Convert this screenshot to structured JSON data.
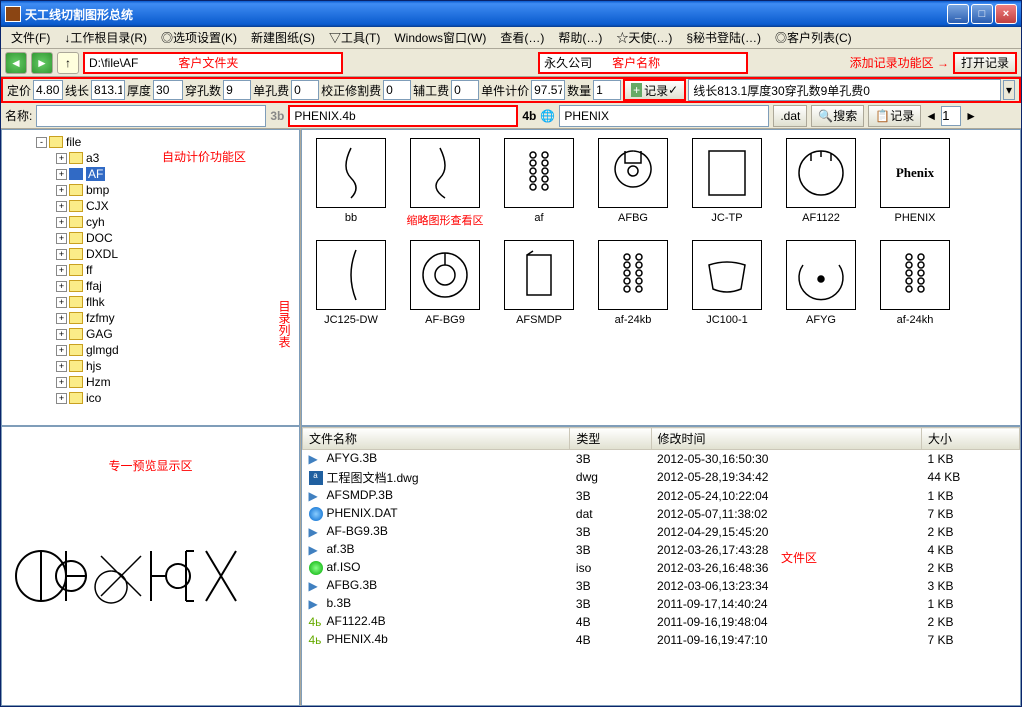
{
  "title": "天工线切割图形总统",
  "menu": [
    "文件(F)",
    "↓工作根目录(R)",
    "◎选项设置(K)",
    "新建图纸(S)",
    "▽工具(T)",
    "Windows窗口(W)",
    "查看(…)",
    "帮助(…)",
    "☆天使(…)",
    "§秘书登陆(…)",
    "◎客户列表(C)"
  ],
  "nav": {
    "path": "D:\\file\\AF"
  },
  "annotations": {
    "customer_folder": "客户文件夹",
    "customer_name": "客户名称",
    "add_record_area": "添加记录功能区 →",
    "open_record": "打开记录",
    "auto_price_area": "自动计价功能区",
    "thumb_area": "缩略图形查看区",
    "dir_list": "目录列表",
    "preview_area": "专一预览显示区",
    "file_area": "文件区"
  },
  "customer": "永久公司",
  "pricing": {
    "dj_label": "定价",
    "dj": "4.80",
    "xc_label": "线长",
    "xc": "813.1",
    "hd_label": "厚度",
    "hd": "30",
    "cks_label": "穿孔数",
    "cks": "9",
    "dkf_label": "单孔费",
    "dkf": "0",
    "jzxgf_label": "校正修割费",
    "jzxgf": "0",
    "fgf_label": "辅工费",
    "fgf": "0",
    "djjj_label": "单件计价",
    "djjj": "97.57",
    "sl_label": "数量",
    "sl": "1",
    "record_btn": "记录",
    "record_text": "线长813.1厚度30穿孔数9单孔费0"
  },
  "namebar": {
    "name_label": "名称:",
    "name_val": "",
    "f3b": "3b",
    "f4b_val": "PHENIX.4b",
    "f4b": "4b",
    "dat_val": "PHENIX",
    "dat_ext": ".dat",
    "search": "搜索",
    "record2": "记录",
    "page": "1"
  },
  "tree": {
    "root": "file",
    "children": [
      "a3",
      "AF",
      "bmp",
      "CJX",
      "cyh",
      "DOC",
      "DXDL",
      "ff",
      "ffaj",
      "flhk",
      "fzfmy",
      "GAG",
      "glmgd",
      "hjs",
      "Hzm",
      "ico"
    ],
    "selected": "AF"
  },
  "thumbs": [
    {
      "label": "bb",
      "svg": "curve1"
    },
    {
      "label": "",
      "svg": "curve2",
      "redtext": true
    },
    {
      "label": "af",
      "svg": "dots"
    },
    {
      "label": "AFBG",
      "svg": "bulb"
    },
    {
      "label": "JC-TP",
      "svg": "rect"
    },
    {
      "label": "AF1122",
      "svg": "circle1"
    },
    {
      "label": "PHENIX",
      "svg": "text",
      "text": "Phenix"
    },
    {
      "label": "JC125-DW",
      "svg": "curve3"
    },
    {
      "label": "AF-BG9",
      "svg": "circle2"
    },
    {
      "label": "AFSMDP",
      "svg": "rect2"
    },
    {
      "label": "af-24kb",
      "svg": "dots"
    },
    {
      "label": "JC100-1",
      "svg": "trap"
    },
    {
      "label": "AFYG",
      "svg": "arc"
    },
    {
      "label": "af-24kh",
      "svg": "dots"
    }
  ],
  "filelist": {
    "cols": [
      "文件名称",
      "类型",
      "修改时间",
      "大小"
    ],
    "rows": [
      {
        "icon": "3b",
        "name": "AFYG.3B",
        "type": "3B",
        "mtime": "2012-05-30,16:50:30",
        "size": "1 KB"
      },
      {
        "icon": "dwg",
        "name": "工程图文档1.dwg",
        "type": "dwg",
        "mtime": "2012-05-28,19:34:42",
        "size": "44 KB"
      },
      {
        "icon": "3b",
        "name": "AFSMDP.3B",
        "type": "3B",
        "mtime": "2012-05-24,10:22:04",
        "size": "1 KB"
      },
      {
        "icon": "dat",
        "name": "PHENIX.DAT",
        "type": "dat",
        "mtime": "2012-05-07,11:38:02",
        "size": "7 KB"
      },
      {
        "icon": "3b",
        "name": "AF-BG9.3B",
        "type": "3B",
        "mtime": "2012-04-29,15:45:20",
        "size": "2 KB"
      },
      {
        "icon": "3b",
        "name": "af.3B",
        "type": "3B",
        "mtime": "2012-03-26,17:43:28",
        "size": "4 KB"
      },
      {
        "icon": "iso",
        "name": "af.ISO",
        "type": "iso",
        "mtime": "2012-03-26,16:48:36",
        "size": "2 KB"
      },
      {
        "icon": "3b",
        "name": "AFBG.3B",
        "type": "3B",
        "mtime": "2012-03-06,13:23:34",
        "size": "3 KB"
      },
      {
        "icon": "3b",
        "name": "b.3B",
        "type": "3B",
        "mtime": "2011-09-17,14:40:24",
        "size": "1 KB"
      },
      {
        "icon": "4b",
        "name": "AF1122.4B",
        "type": "4B",
        "mtime": "2011-09-16,19:48:04",
        "size": "2 KB"
      },
      {
        "icon": "4b",
        "name": "PHENIX.4b",
        "type": "4B",
        "mtime": "2011-09-16,19:47:10",
        "size": "7 KB"
      }
    ]
  }
}
